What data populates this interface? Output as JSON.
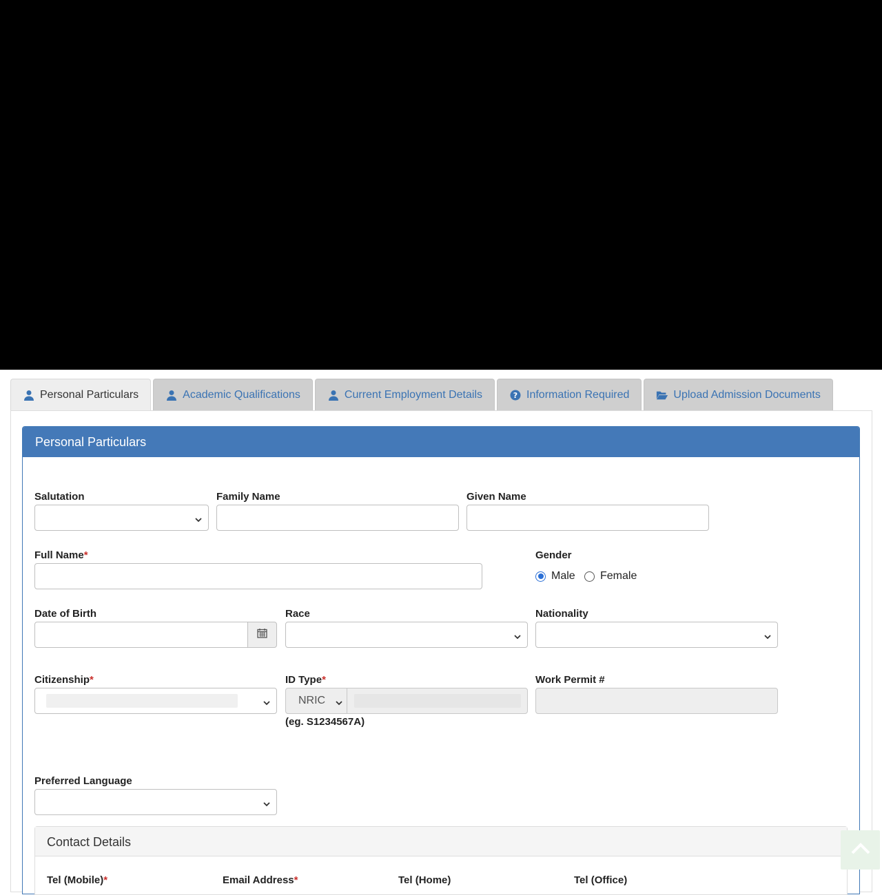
{
  "tabs": [
    {
      "label": "Personal Particulars",
      "icon": "user-icon",
      "active": true
    },
    {
      "label": "Academic Qualifications",
      "icon": "user-icon",
      "active": false
    },
    {
      "label": "Current Employment Details",
      "icon": "user-icon",
      "active": false
    },
    {
      "label": "Information Required",
      "icon": "question-circle-icon",
      "active": false
    },
    {
      "label": "Upload Admission Documents",
      "icon": "folder-open-icon",
      "active": false
    }
  ],
  "panel": {
    "title": "Personal Particulars"
  },
  "fields": {
    "salutation": {
      "label": "Salutation",
      "value": ""
    },
    "family_name": {
      "label": "Family Name",
      "value": ""
    },
    "given_name": {
      "label": "Given Name",
      "value": ""
    },
    "full_name": {
      "label": "Full Name",
      "required_mark": "*",
      "value": ""
    },
    "gender": {
      "label": "Gender",
      "options": [
        "Male",
        "Female"
      ],
      "selected": "Male"
    },
    "date_of_birth": {
      "label": "Date of Birth",
      "value": ""
    },
    "race": {
      "label": "Race",
      "value": ""
    },
    "nationality": {
      "label": "Nationality",
      "value": ""
    },
    "citizenship": {
      "label": "Citizenship",
      "required_mark": "*",
      "value": ""
    },
    "id_type": {
      "label": "ID Type",
      "required_mark": "*",
      "type_value": "NRIC",
      "number_value": "",
      "hint": "(eg. S1234567A)"
    },
    "work_permit": {
      "label": "Work Permit #",
      "value": ""
    },
    "preferred_language": {
      "label": "Preferred Language",
      "value": ""
    }
  },
  "contact": {
    "title": "Contact Details",
    "columns": [
      {
        "label": "Tel (Mobile)",
        "required_mark": "*"
      },
      {
        "label": "Email Address",
        "required_mark": "*"
      },
      {
        "label": "Tel (Home)",
        "required_mark": ""
      },
      {
        "label": "Tel (Office)",
        "required_mark": ""
      }
    ]
  },
  "colors": {
    "accent": "#4479b8",
    "tab_text": "#3a73b3",
    "required": "#c9302c"
  }
}
